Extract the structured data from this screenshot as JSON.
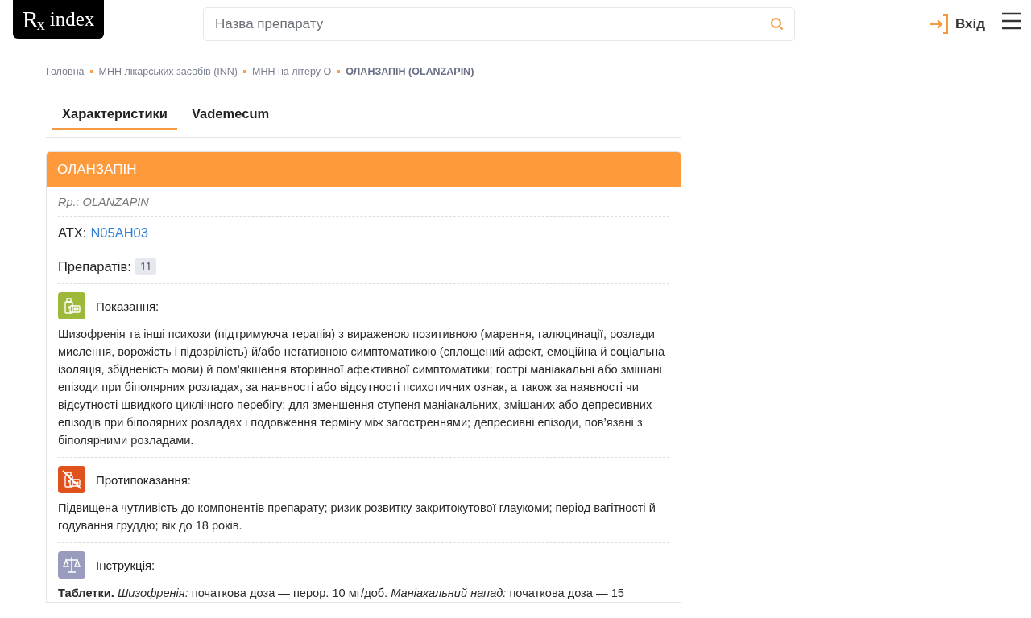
{
  "header": {
    "logo": {
      "mark": "R",
      "mark_sub": "x",
      "text": "index"
    },
    "search": {
      "placeholder": "Назва препарату"
    },
    "login": "Вхід"
  },
  "breadcrumbs": [
    {
      "label": "Головна",
      "current": false
    },
    {
      "label": "МНН лікарських засобів (INN)",
      "current": false
    },
    {
      "label": "МНН на літеру О",
      "current": false
    },
    {
      "label": "ОЛАНЗАПІН (OLANZAPIN)",
      "current": true
    }
  ],
  "tabs": [
    {
      "label": "Характеристики",
      "selected": true
    },
    {
      "label": "Vademecum",
      "selected": false
    }
  ],
  "card": {
    "title": "ОЛАНЗАПІН",
    "latin": "Rp.: OLANZAPIN",
    "atc_label": "АТХ:",
    "atc_code": "N05AH03",
    "count_label": "Препаратів:",
    "count": "11",
    "sections": [
      {
        "kind": "indications",
        "color": "#9cb93a",
        "title": "Показання:",
        "text": "Шизофренія та інші психози (підтримуюча терапія) з вираженою позитивною (марення, галюцинації, розлади мислення, ворожість і підозрілість) й/або негативною симптоматикою (сплощений афект, емоційна й соціальна ізоляція, збідненість мови) й пом’якшення вторинної афективної симптоматики; гострі маніакальні або змішані епізоди при біполярних розладах, за наявності або відсутності психотичних ознак, а також за наявності чи відсутності швидкого циклічного перебігу; для зменшення ступеня маніакальних, змішаних або депресивних епізодів при біполярних розладах і подовження терміну між загостреннями; депресивні епізоди, пов’язані з біполярними розладами."
      },
      {
        "kind": "contraindications",
        "color": "#e0521b",
        "title": "Протипоказання:",
        "text": "Підвищена чутливість до компонентів препарату; ризик розвитку закритокутової глаукоми; період вагітності й годування груддю; вік до 18 років."
      },
      {
        "kind": "instruction",
        "color": "#9a9cbe",
        "title": "Інструкція:",
        "text": "**Таблетки.** *Шизофренія:* початкова доза — перор. 10 мг/доб. *Маніакальний напад:* початкова доза — 15"
      }
    ]
  }
}
